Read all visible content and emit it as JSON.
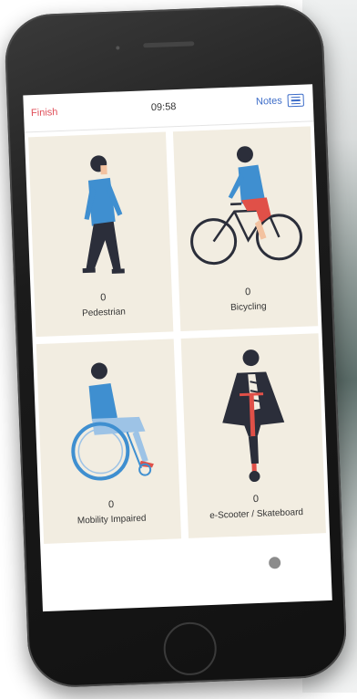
{
  "topbar": {
    "finish_label": "Finish",
    "time": "09:58",
    "notes_label": "Notes",
    "notes_icon": "notes-icon"
  },
  "tiles": [
    {
      "count": "0",
      "label": "Pedestrian",
      "icon": "pedestrian-illustration"
    },
    {
      "count": "0",
      "label": "Bicycling",
      "icon": "bicyclist-illustration"
    },
    {
      "count": "0",
      "label": "Mobility Impaired",
      "icon": "wheelchair-user-illustration"
    },
    {
      "count": "0",
      "label": "e-Scooter / Skateboard",
      "icon": "e-scooter-rider-illustration"
    }
  ],
  "colors": {
    "finish": "#e0505a",
    "notes": "#3c6cc8",
    "tile_background": "#f2ede1",
    "illustration_blue": "#3f8fd0",
    "illustration_red": "#e05048"
  }
}
